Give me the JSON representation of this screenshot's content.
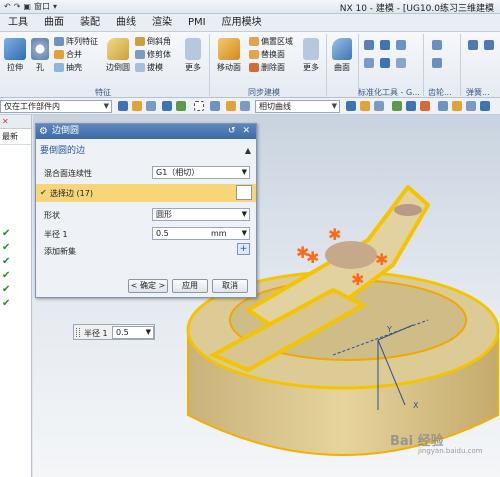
{
  "titlebar": {
    "window_menu": "窗口",
    "title": "NX 10 - 建模 - [UG10.0练习三维建模"
  },
  "menu": {
    "tabs": [
      "工具",
      "曲面",
      "装配",
      "曲线",
      "渲染",
      "PMI",
      "应用模块"
    ]
  },
  "ribbon": {
    "extrude": "拉伸",
    "hole": "孔",
    "array": "阵列特征",
    "unite": "合并",
    "shell": "抽壳",
    "edge_blend": "边倒圆",
    "chamfer": "倒斜角",
    "trim_body": "修剪体",
    "draft": "拔模",
    "more": "更多",
    "feature_group": "特征",
    "move_face": "移动面",
    "offset_region": "偏置区域",
    "replace_face": "替换面",
    "delete_face": "删除面",
    "sync_group": "同步建模",
    "surface": "曲面",
    "standard_group": "标准化工具 - G...",
    "gear_group": "齿轮...",
    "spring_group": "弹簧..."
  },
  "selection_bar": {
    "scope": "仅在工作部件内",
    "curve_rule": "相切曲线"
  },
  "navigator": {
    "header": "最新"
  },
  "dialog": {
    "title": "边倒圆",
    "section_edges": "要倒圆的边",
    "continuity_label": "混合面连续性",
    "continuity_value": "G1（相切）",
    "select_edge": "选择边 (17)",
    "shape_label": "形状",
    "shape_value": "圆形",
    "radius_label": "半径 1",
    "radius_value": "0.5",
    "radius_unit": "mm",
    "add_set": "添加新集",
    "ok": "< 确定 >",
    "apply": "应用",
    "cancel": "取消"
  },
  "onscreen_input": {
    "label": "半径 1",
    "value": "0.5"
  },
  "watermark": {
    "logo": "Bai 经验",
    "url": "jingyan.baidu.com"
  },
  "colors": {
    "highlight": "#f5c400",
    "selected_row": "#f9d57a",
    "dialog_title": "#4a76b0",
    "part": "#d8c48a"
  }
}
